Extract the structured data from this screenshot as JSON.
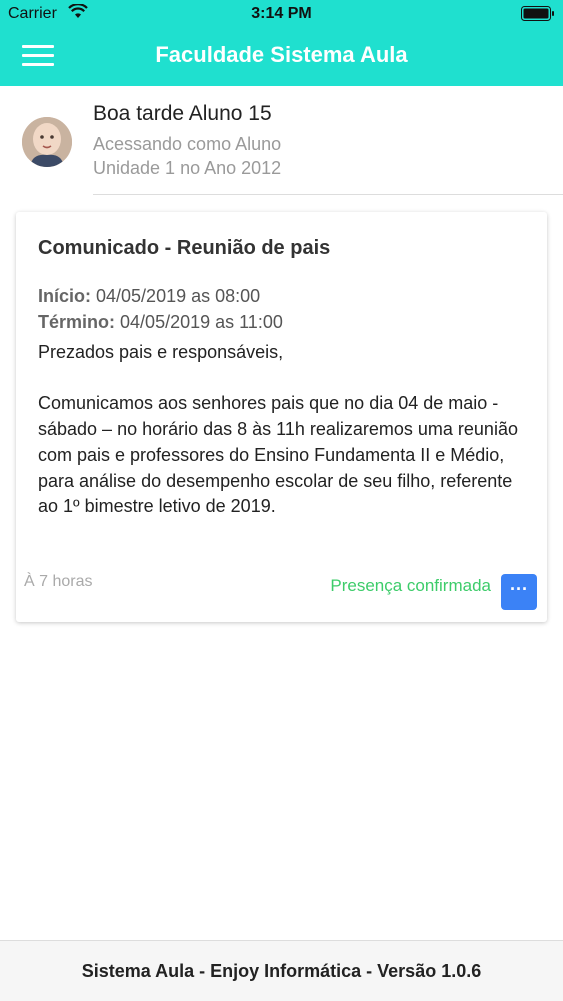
{
  "status_bar": {
    "carrier": "Carrier",
    "time": "3:14 PM",
    "icons": [
      "wifi-icon",
      "battery-icon"
    ]
  },
  "header": {
    "title": "Faculdade Sistema Aula",
    "menu_icon": "hamburger-menu-icon",
    "background_color": "#1fe0cf"
  },
  "user": {
    "greeting": "Boa tarde Aluno 15",
    "role": "Acessando como Aluno",
    "unit": "Unidade 1 no Ano 2012"
  },
  "card": {
    "title": "Comunicado - Reunião de pais",
    "start_label": "Início:",
    "start_value": "04/05/2019 as 08:00",
    "end_label": "Término:",
    "end_value": "04/05/2019 as 11:00",
    "body": "Prezados pais e responsáveis,\n\nComunicamos aos senhores pais que no dia 04 de maio - sábado – no horário das 8 às 11h realizaremos uma reunião com pais e professores do Ensino Fundamenta II e Médio,\npara análise do desempenho escolar de seu filho, referente ao 1º bimestre letivo de 2019.",
    "time_ago": "À 7 horas",
    "presence_status": "Presença confirmada",
    "more_button_label": "···",
    "presence_color": "#3dcc6a",
    "button_color": "#3b82f6"
  },
  "footer": {
    "text": "Sistema Aula - Enjoy Informática - Versão 1.0.6"
  }
}
